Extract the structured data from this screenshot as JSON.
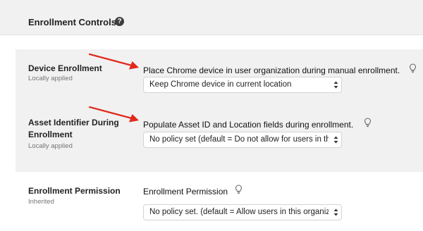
{
  "header": {
    "title": "Enrollment Controls",
    "help_glyph": "?"
  },
  "settings": [
    {
      "label_lines": [
        "Device Enrollment"
      ],
      "sub": "Locally applied",
      "policy_text": "Place Chrome device in user organization during manual enrollment.",
      "selected_value": "Keep Chrome device in current location"
    },
    {
      "label_lines": [
        "Asset Identifier During",
        "Enrollment"
      ],
      "sub": "Locally applied",
      "policy_text": "Populate Asset ID and Location fields during enrollment.",
      "selected_value": "No policy set (default = Do not allow for users in this organization)"
    },
    {
      "label_lines": [
        "Enrollment Permission"
      ],
      "sub": "Inherited",
      "policy_text": "Enrollment Permission",
      "selected_value": "No policy set. (default = Allow users in this organization to enroll)"
    }
  ],
  "icons": {
    "help": "question-mark-circle-icon",
    "hint": "lightbulb-icon",
    "select": "updown-chevron-icon",
    "annotation": "red-arrow"
  },
  "colors": {
    "header_bg": "#f1f1f1",
    "panel_bg": "#f1f1f1",
    "annotation_arrow": "#e0291c",
    "muted_text": "#757575"
  }
}
